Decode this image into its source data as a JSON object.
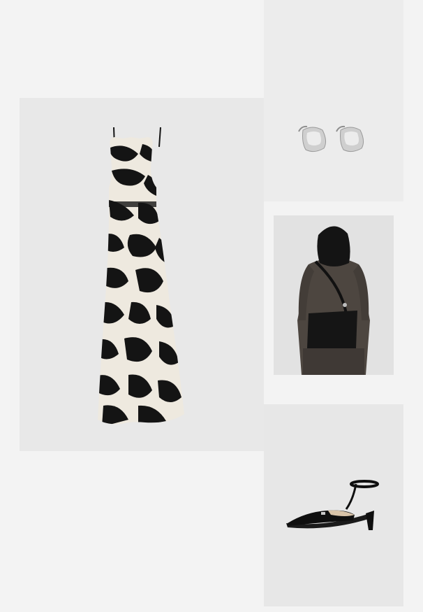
{
  "collage": {
    "items": [
      {
        "id": "dress",
        "kind": "printed maxi dress"
      },
      {
        "id": "earrings",
        "kind": "silver hoop earrings"
      },
      {
        "id": "bag",
        "kind": "black suede shoulder bag"
      },
      {
        "id": "shoe",
        "kind": "black slingback kitten heel"
      }
    ]
  },
  "colors": {
    "page_background": "#f3f3f3",
    "tile_background": "#e8e8e8",
    "print_dark": "#141414",
    "print_light": "#eee9df",
    "silver": "#c9c9c9",
    "leather_coat": "#4d4640",
    "bag_black": "#151515",
    "shoe_black": "#0f0f0f"
  }
}
